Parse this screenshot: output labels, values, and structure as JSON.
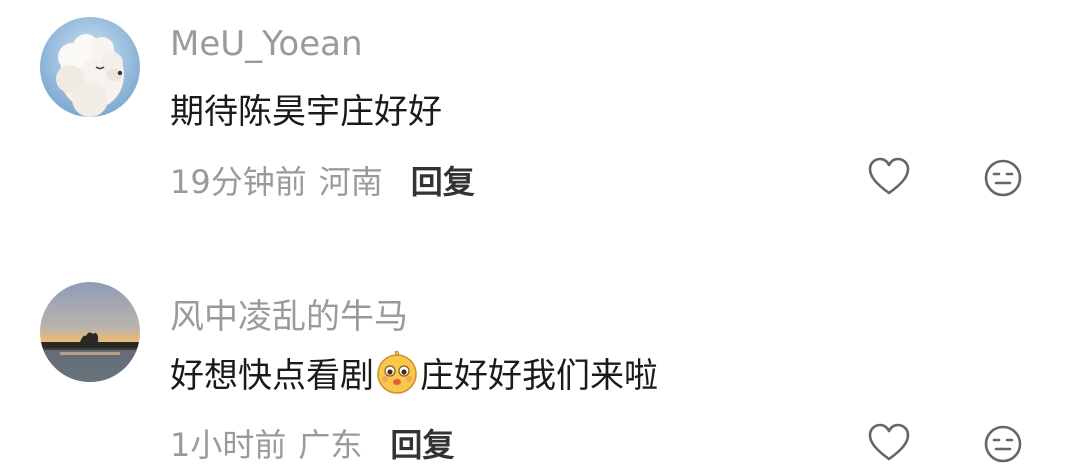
{
  "comments": [
    {
      "username": "MeU_Yoean",
      "text": "期待陈昊宇庄好好",
      "time": "19分钟前",
      "location": "河南",
      "reply_label": "回复",
      "avatar_icon": "white-dog-avatar",
      "like_icon": "heart-icon",
      "react_icon": "neutral-face-icon"
    },
    {
      "username": "风中凌乱的牛马",
      "text_before": "好想快点看剧",
      "inline_emoji": "drooling-face-emoji",
      "text_after": "庄好好我们来啦",
      "time": "1小时前",
      "location": "广东",
      "reply_label": "回复",
      "avatar_icon": "sunset-lake-avatar"
    }
  ],
  "colors": {
    "username": "#9a9a9a",
    "text": "#1a1a1a",
    "meta": "#9a9a9a",
    "reply": "#333333",
    "icon": "#666666"
  }
}
